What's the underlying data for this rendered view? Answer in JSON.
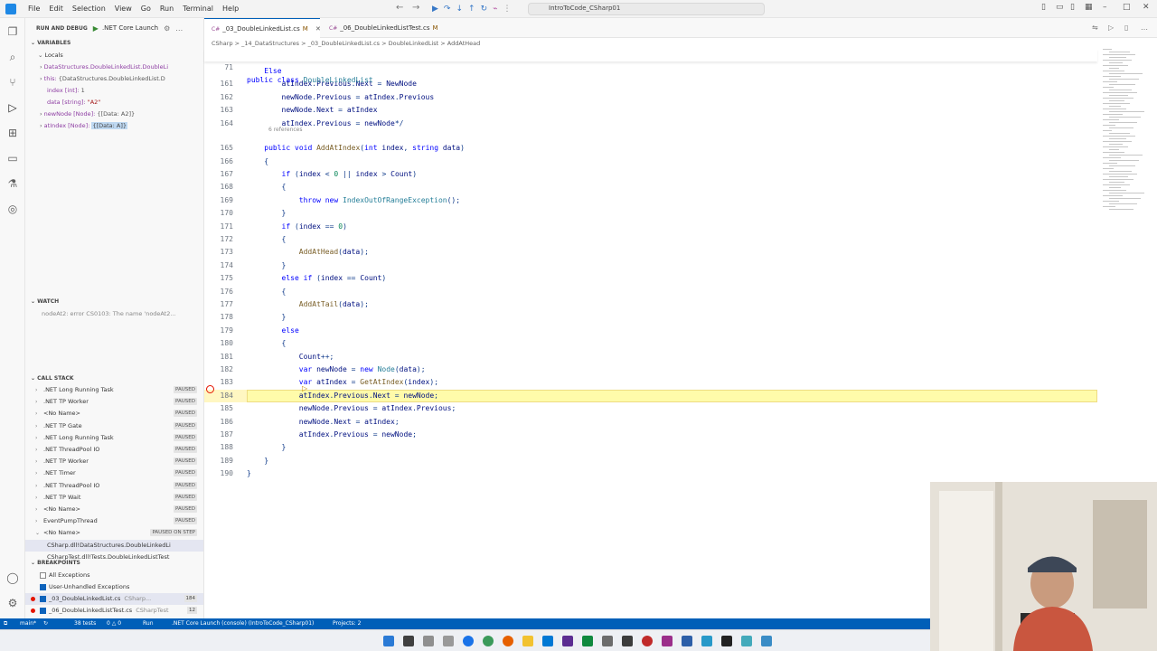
{
  "menu": [
    "File",
    "Edit",
    "Selection",
    "View",
    "Go",
    "Run",
    "Terminal",
    "Help"
  ],
  "search_text": "IntroToCode_CSharp01",
  "run_panel": {
    "title": "RUN AND DEBUG",
    "config": ".NET Core Launch"
  },
  "variables": {
    "header": "VARIABLES",
    "locals_header": "Locals",
    "lines": [
      {
        "key": "DataStructures.DoubleLinkedList.DoubleLi",
        "val": ""
      },
      {
        "key": "this: ",
        "val": "{DataStructures.DoubleLinkedList.D"
      },
      {
        "key": "index [int]: ",
        "val": "1"
      },
      {
        "key": "data [string]: ",
        "val": "\"A2\""
      },
      {
        "key": "newNode [Node]: ",
        "val": "{[Data: A2]}"
      },
      {
        "key": "atIndex [Node]: ",
        "val": "{[Data: A]}"
      }
    ]
  },
  "watch": {
    "header": "WATCH",
    "entry": "nodeAt2: error CS0103: The name 'nodeAt2..."
  },
  "call_stack": {
    "header": "CALL STACK",
    "rows": [
      {
        "name": ".NET Long Running Task",
        "status": "PAUSED"
      },
      {
        "name": ".NET TP Worker",
        "status": "PAUSED"
      },
      {
        "name": "<No Name>",
        "status": "PAUSED"
      },
      {
        "name": ".NET TP Gate",
        "status": "PAUSED"
      },
      {
        "name": ".NET Long Running Task",
        "status": "PAUSED"
      },
      {
        "name": ".NET ThreadPool IO",
        "status": "PAUSED"
      },
      {
        "name": ".NET TP Worker",
        "status": "PAUSED"
      },
      {
        "name": ".NET Timer",
        "status": "PAUSED"
      },
      {
        "name": ".NET ThreadPool IO",
        "status": "PAUSED"
      },
      {
        "name": ".NET TP Wait",
        "status": "PAUSED"
      },
      {
        "name": "<No Name>",
        "status": "PAUSED"
      },
      {
        "name": "EventPumpThread",
        "status": "PAUSED"
      },
      {
        "name": "<No Name>",
        "status": "PAUSED ON STEP"
      },
      {
        "name": "CSharp.dll!DataStructures.DoubleLinkedLi",
        "status": ""
      },
      {
        "name": "CSharpTest.dll!Tests.DoubleLinkedListTest",
        "status": ""
      }
    ]
  },
  "breakpoints": {
    "header": "BREAKPOINTS",
    "items": [
      {
        "label": "All Exceptions",
        "sub": "",
        "count": ""
      },
      {
        "label": "User-Unhandled Exceptions",
        "sub": "",
        "count": ""
      },
      {
        "label": "_03_DoubleLinkedList.cs",
        "sub": "CSharp...",
        "count": "184"
      },
      {
        "label": "_06_DoubleLinkedListTest.cs",
        "sub": "CSharpTest",
        "count": "12"
      }
    ]
  },
  "tabs": [
    {
      "label": "_03_DoubleLinkedList.cs",
      "mod": "M"
    },
    {
      "label": "_06_DoubleLinkedListTest.cs",
      "mod": "M"
    }
  ],
  "breadcrumb": "CSharp > _14_DataStructures > _03_DoubleLinkedList.cs > DoubleLinkedList > AddAtHead",
  "editor": {
    "sticky": {
      "ln": "71",
      "text": "public class DoubleLinkedList"
    },
    "refs": "6 references",
    "lines": [
      {
        "ln": "",
        "text": "    Else"
      },
      {
        "ln": "161",
        "text": "        atIndex.Previous.Next = NewNode"
      },
      {
        "ln": "162",
        "text": "        newNode.Previous = atIndex.Previous"
      },
      {
        "ln": "163",
        "text": "        newNode.Next = atIndex"
      },
      {
        "ln": "164",
        "text": "        atIndex.Previous = newNode*/"
      },
      {
        "ln": "165",
        "text": "    public void AddAtIndex(int index, string data)"
      },
      {
        "ln": "166",
        "text": "    {"
      },
      {
        "ln": "167",
        "text": "        if (index < 0 || index > Count)"
      },
      {
        "ln": "168",
        "text": "        {"
      },
      {
        "ln": "169",
        "text": "            throw new IndexOutOfRangeException();"
      },
      {
        "ln": "170",
        "text": "        }"
      },
      {
        "ln": "171",
        "text": "        if (index == 0)"
      },
      {
        "ln": "172",
        "text": "        {"
      },
      {
        "ln": "173",
        "text": "            AddAtHead(data);"
      },
      {
        "ln": "174",
        "text": "        }"
      },
      {
        "ln": "175",
        "text": "        else if (index == Count)"
      },
      {
        "ln": "176",
        "text": "        {"
      },
      {
        "ln": "177",
        "text": "            AddAtTail(data);"
      },
      {
        "ln": "178",
        "text": "        }"
      },
      {
        "ln": "179",
        "text": "        else"
      },
      {
        "ln": "180",
        "text": "        {"
      },
      {
        "ln": "181",
        "text": "            Count++;"
      },
      {
        "ln": "182",
        "text": "            var newNode = new Node(data);"
      },
      {
        "ln": "183",
        "text": "            var atIndex = GetAtIndex(index);"
      },
      {
        "ln": "184",
        "text": "            atIndex.Previous.Next = newNode;"
      },
      {
        "ln": "185",
        "text": "            newNode.Previous = atIndex.Previous;"
      },
      {
        "ln": "186",
        "text": "            newNode.Next = atIndex;"
      },
      {
        "ln": "187",
        "text": "            atIndex.Previous = newNode;"
      },
      {
        "ln": "188",
        "text": "        }"
      },
      {
        "ln": "189",
        "text": "    }"
      },
      {
        "ln": "190",
        "text": "}"
      }
    ]
  },
  "status": {
    "branch": "main*",
    "sync": "38 tests",
    "problems": "0 △ 0",
    "run": "Run",
    "launch": ".NET Core Launch (console) (IntroToCode_CSharp01)",
    "projects": "Projects: 2"
  },
  "colors": {
    "accent": "#005fb8",
    "highlight": "#fffbaa",
    "breakpoint": "#e51400"
  }
}
